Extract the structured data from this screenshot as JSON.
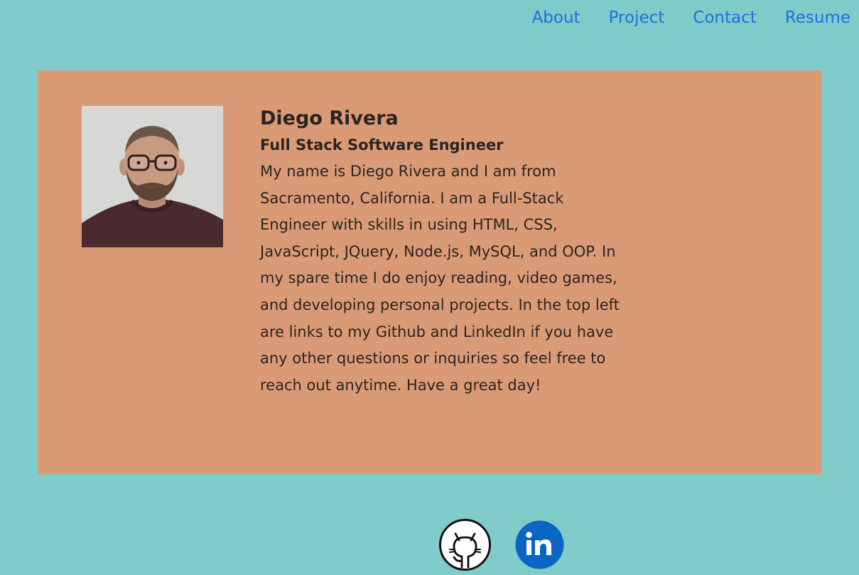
{
  "nav": {
    "items": [
      {
        "label": "About"
      },
      {
        "label": "Project"
      },
      {
        "label": "Contact"
      },
      {
        "label": "Resume"
      }
    ]
  },
  "profile": {
    "name": "Diego Rivera",
    "title": "Full Stack Software Engineer",
    "bio": "My name is Diego Rivera and I am from Sacramento, California. I am a Full-Stack Engineer with skills in using HTML, CSS, JavaScript, JQuery, Node.js, MySQL, and OOP. In my spare time I do enjoy reading, video games, and developing personal projects. In the top left are links to my Github and LinkedIn if you have any other questions or inquiries so feel free to reach out anytime. Have a great day!"
  },
  "socials": [
    {
      "icon": "github-icon"
    },
    {
      "icon": "linkedin-icon"
    }
  ],
  "colors": {
    "background": "#7fcbc9",
    "card": "#da9a75",
    "link": "#1f6fe0",
    "text": "#2a2523",
    "linkedin": "#0a66c2"
  }
}
